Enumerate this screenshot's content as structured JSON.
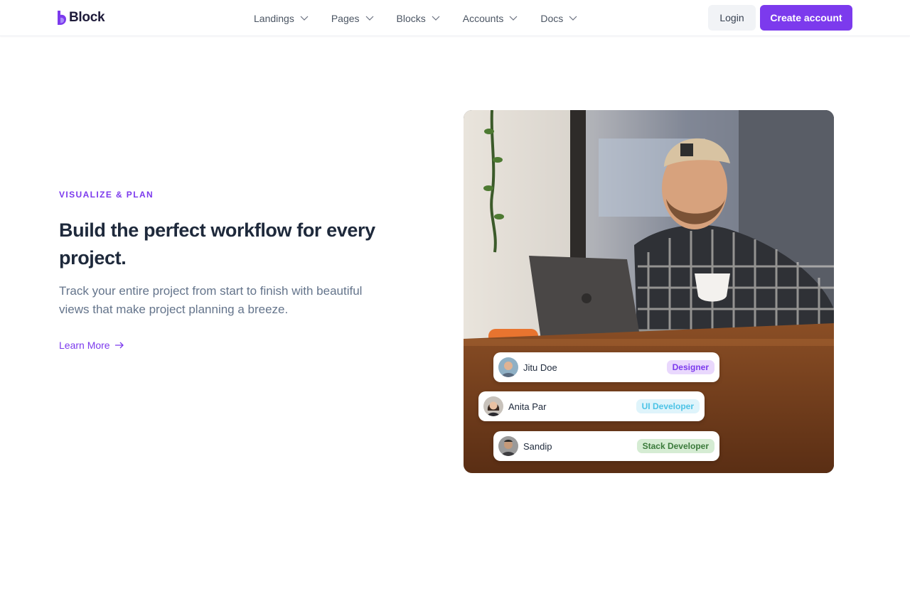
{
  "brand": {
    "name": "Block",
    "accent": "#7c3aed"
  },
  "nav": {
    "items": [
      {
        "label": "Landings"
      },
      {
        "label": "Pages"
      },
      {
        "label": "Blocks"
      },
      {
        "label": "Accounts"
      },
      {
        "label": "Docs"
      }
    ],
    "login_label": "Login",
    "create_label": "Create account"
  },
  "hero": {
    "eyebrow": "VISUALIZE & PLAN",
    "headline": "Build the perfect workflow for every project.",
    "subtext": "Track your entire project from start to finish with beautiful views that make project planning a breeze.",
    "cta_label": "Learn More"
  },
  "team": [
    {
      "name": "Jitu Doe",
      "role": "Designer",
      "role_color": "#7c3aed"
    },
    {
      "name": "Anita Par",
      "role": "UI Developer",
      "role_color": "#4cc3e6"
    },
    {
      "name": "Sandip",
      "role": "Stack Developer",
      "role_color": "#3a7a3a"
    }
  ],
  "icons": {
    "logo": "block-logo-icon",
    "nav_caret": "chevron-down-icon",
    "cta_arrow": "arrow-right-icon"
  }
}
